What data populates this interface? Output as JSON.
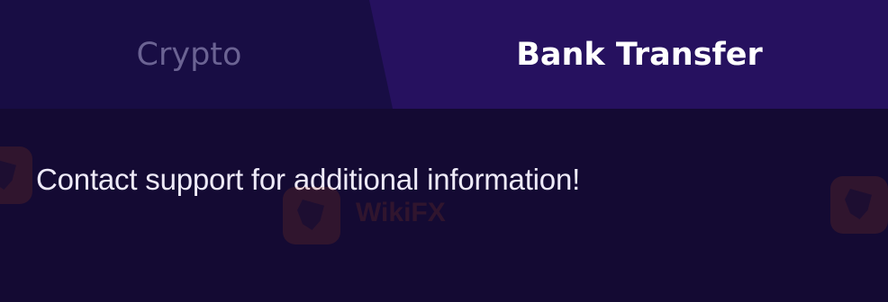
{
  "tabs": [
    {
      "label": "Crypto",
      "active": false
    },
    {
      "label": "Bank Transfer",
      "active": true
    }
  ],
  "content": {
    "message": "Contact support for additional information!"
  },
  "colors": {
    "background": "#140a33",
    "tab_bar_background": "#180d44",
    "active_tab_background": "#26115f",
    "inactive_tab_text": "#6b6393",
    "active_tab_text": "#ffffff",
    "message_text": "#eeeaf8"
  },
  "watermark": {
    "icon": "eagle-logo-icon",
    "text": "WikiFX"
  }
}
